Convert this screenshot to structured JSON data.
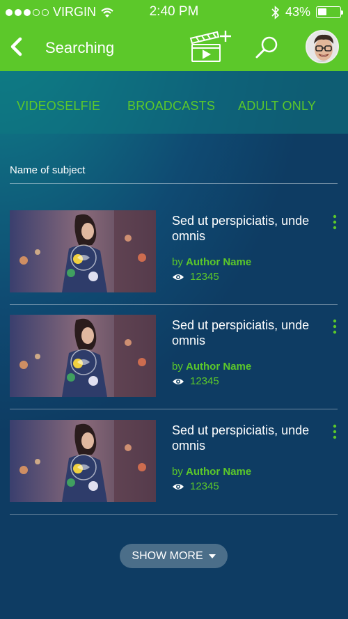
{
  "status_bar": {
    "carrier": "VIRGIN",
    "time": "2:40 PM",
    "battery": "43%",
    "battery_level": 0.43,
    "signal_icon": "signal-dots-icon",
    "wifi_icon": "wifi-icon",
    "bluetooth_icon": "bluetooth-icon"
  },
  "header": {
    "title": "Searching",
    "back_icon": "chevron-left-icon",
    "add_video_icon": "clapperboard-plus-icon",
    "search_icon": "search-icon",
    "avatar_icon": "user-avatar"
  },
  "tabs": [
    {
      "label": "VIDEOSELFIE"
    },
    {
      "label": "BROADCASTS"
    },
    {
      "label": "ADULT ONLY"
    }
  ],
  "subject_label": "Name of subject",
  "items": [
    {
      "title": "Sed ut perspiciatis, unde omnis",
      "by": "by",
      "author": "Author Name",
      "views": "12345"
    },
    {
      "title": "Sed ut perspiciatis, unde omnis",
      "by": "by",
      "author": "Author Name",
      "views": "12345"
    },
    {
      "title": "Sed ut perspiciatis, unde omnis",
      "by": "by",
      "author": "Author Name",
      "views": "12345"
    }
  ],
  "show_more": "SHOW MORE",
  "colors": {
    "accent": "#5cc82a",
    "background": "#0e3c63",
    "text": "#ffffff"
  }
}
